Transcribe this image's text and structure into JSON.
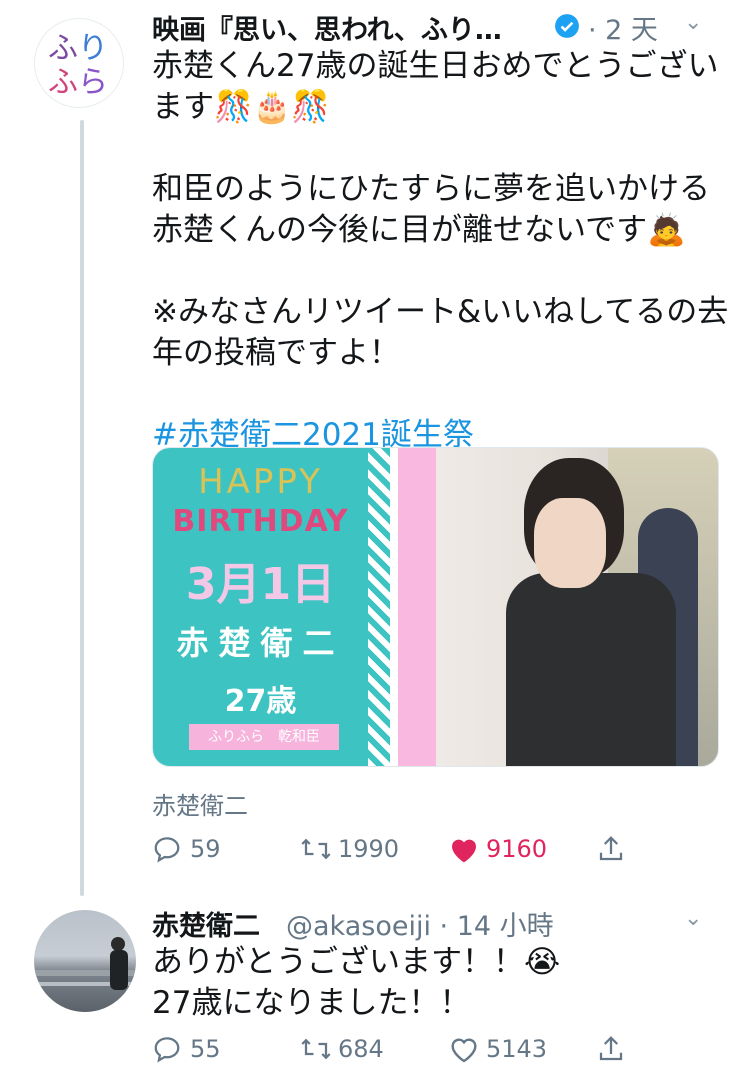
{
  "tweet1": {
    "name": "映画『思い、思われ、ふり…",
    "time": "· 2 天",
    "lines": [
      "赤楚くん27歳の誕生日おめでとうござい",
      "ます🎊🎂🎊",
      "",
      "和臣のようにひたすらに夢を追いかける",
      "赤楚くんの今後に目が離せないです🙇",
      "",
      "※みなさんリツイート&いいねしてるの去",
      "年の投稿ですよ！",
      "",
      "#赤楚衛二2021誕生祭"
    ],
    "card": {
      "happy": "HAPPY",
      "birthday": "BIRTHDAY",
      "date": "3月1日",
      "name": "赤楚衛二",
      "age": "27歳",
      "tag": "ふりふら　乾和臣"
    },
    "caption": "赤楚衛二",
    "actions": {
      "replies": "59",
      "retweets": "1990",
      "likes": "9160"
    }
  },
  "tweet2": {
    "name": "赤楚衛二",
    "handle": "@akasoeiji · 14 小時",
    "lines": [
      "ありがとうございます！！😭",
      "27歳になりました！！"
    ],
    "actions": {
      "replies": "55",
      "retweets": "684",
      "likes": "5143"
    }
  },
  "colors": {
    "accent": "#1b95e0",
    "like": "#e0245e",
    "muted": "#657786",
    "verified": "#1da1f2"
  },
  "icons": [
    "reply-icon",
    "retweet-icon",
    "like-icon",
    "share-icon",
    "verified-icon",
    "chevron-down-icon"
  ]
}
